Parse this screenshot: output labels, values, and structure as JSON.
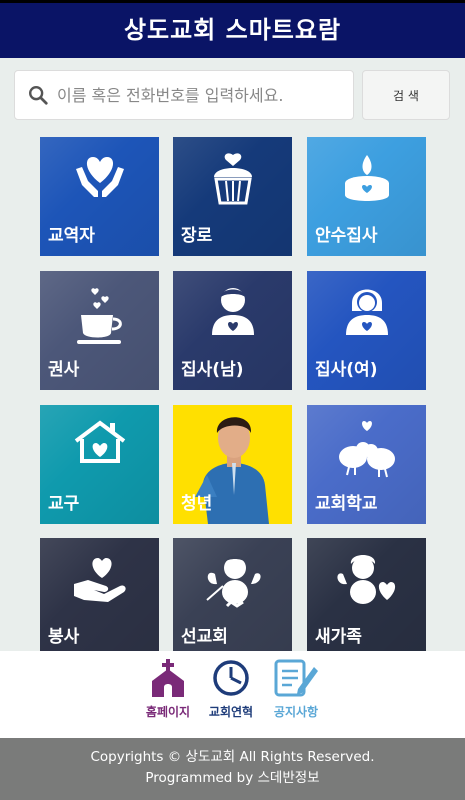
{
  "header": {
    "title": "상도교회 스마트요람"
  },
  "search": {
    "placeholder": "이름 혹은 전화번호를 입력하세요.",
    "button_label": "검 색"
  },
  "tiles": [
    {
      "label": "교역자",
      "color": "#1d55b8",
      "icon": "hands-heart-icon"
    },
    {
      "label": "장로",
      "color": "#153a7a",
      "icon": "cupcake-heart-icon"
    },
    {
      "label": "안수집사",
      "color": "#3d9fe0",
      "icon": "candle-heart-icon"
    },
    {
      "label": "권사",
      "color": "#4c5779",
      "icon": "coffee-cup-hearts-icon"
    },
    {
      "label": "집사(남)",
      "color": "#2a3a6b",
      "icon": "man-heart-icon"
    },
    {
      "label": "집사(여)",
      "color": "#2455c0",
      "icon": "woman-heart-icon"
    },
    {
      "label": "교구",
      "color": "#0f9aad",
      "icon": "house-heart-icon"
    },
    {
      "label": "청년",
      "color": "#ffe000",
      "icon": "young-man-photo"
    },
    {
      "label": "교회학교",
      "color": "#4a6cc9",
      "icon": "birds-heart-icon"
    },
    {
      "label": "봉사",
      "color": "#2e3347",
      "icon": "hand-heart-icon"
    },
    {
      "label": "선교회",
      "color": "#3a4155",
      "icon": "cupid-icon"
    },
    {
      "label": "새가족",
      "color": "#2a3144",
      "icon": "angel-heart-icon"
    }
  ],
  "nav": [
    {
      "label": "홈페이지",
      "color": "#7a2a78",
      "icon": "church-icon"
    },
    {
      "label": "교회연혁",
      "color": "#1e3c7a",
      "icon": "clock-icon"
    },
    {
      "label": "공지사항",
      "color": "#5aa7d6",
      "icon": "notepad-icon"
    }
  ],
  "footer": {
    "line1": "Copyrights © 상도교회 All Rights Reserved.",
    "line2": "Programmed by 스데반정보"
  }
}
